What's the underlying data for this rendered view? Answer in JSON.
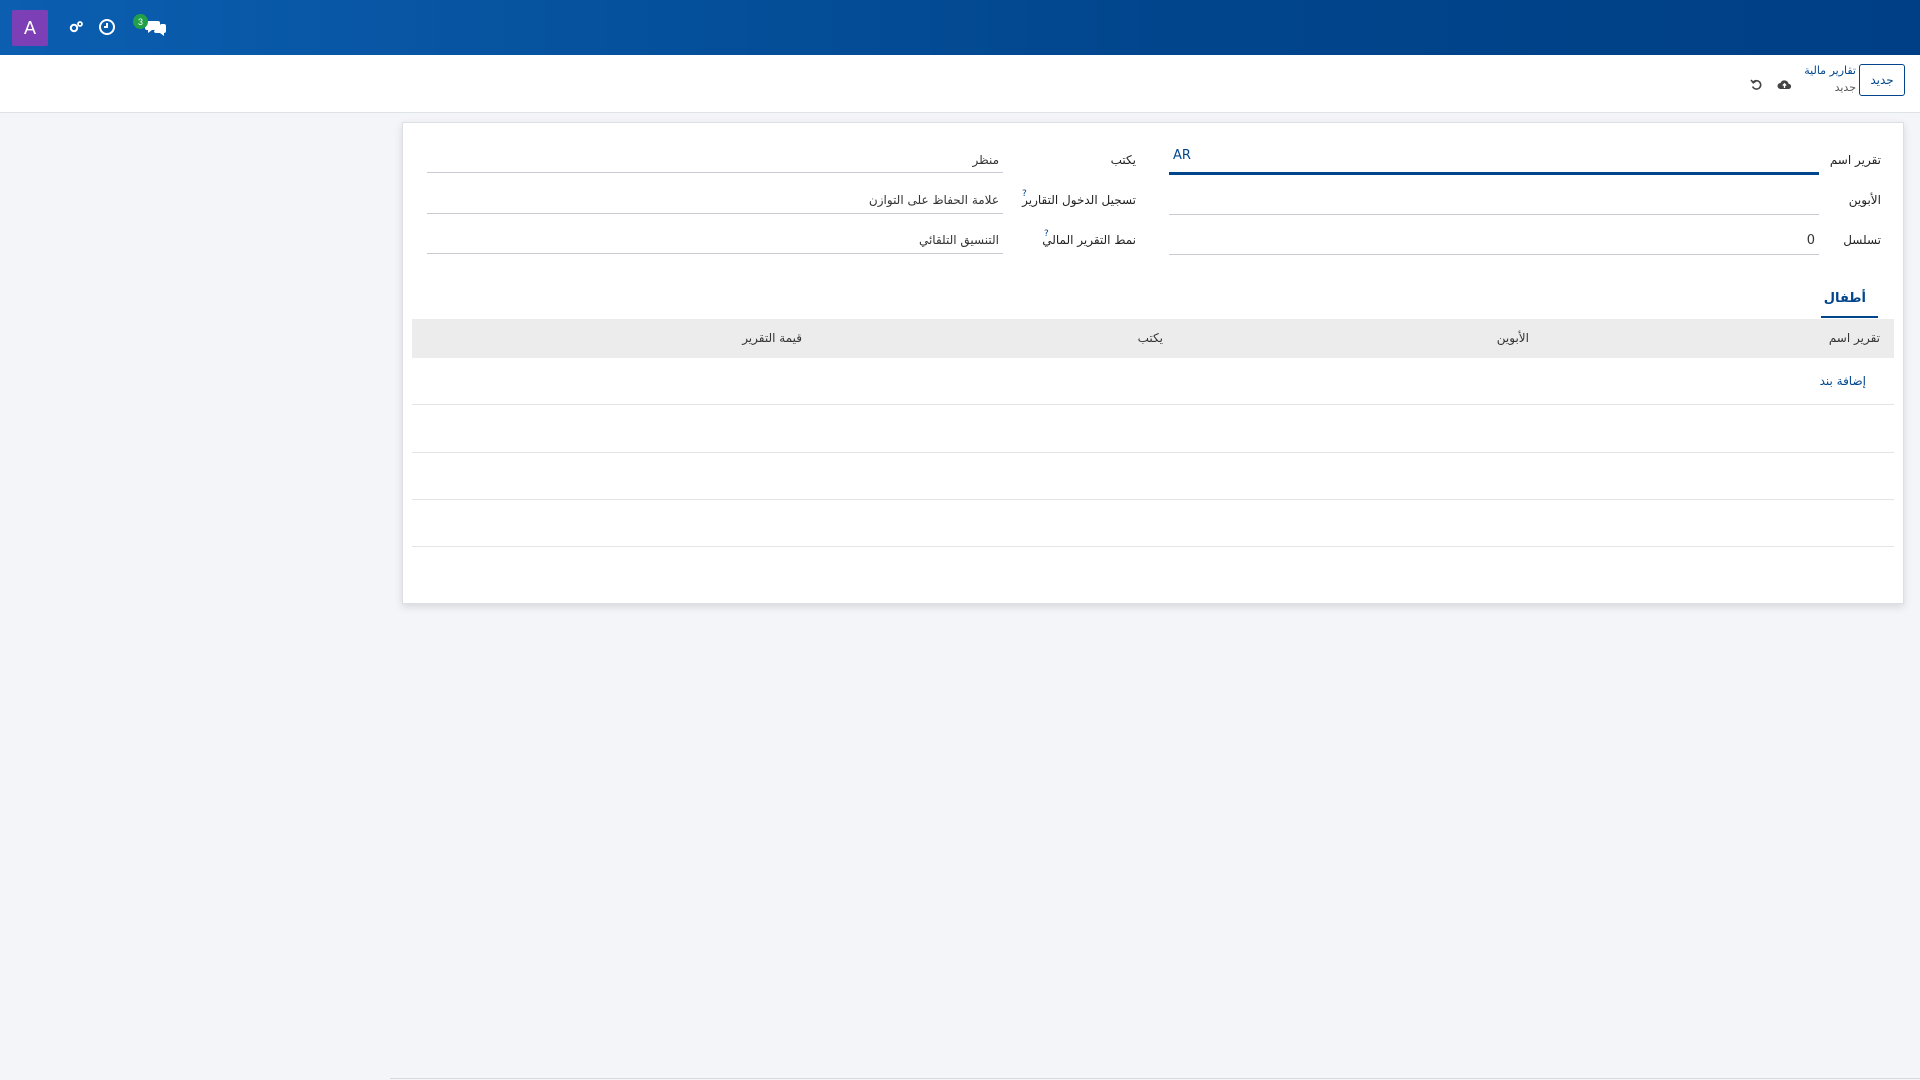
{
  "navbar": {
    "avatar_letter": "A",
    "icons": [
      "settings-icon",
      "clock-icon",
      "chat-icon"
    ],
    "chat_badge": "3"
  },
  "control_panel": {
    "new_button_label": "جديد",
    "breadcrumb_parent": "تقارير مالية",
    "breadcrumb_current": "جديد",
    "icons": [
      "upload-icon",
      "undo-icon"
    ]
  },
  "form": {
    "report_name_label": "تقرير اسم",
    "report_name_value": "AR",
    "parent_label": "الأبوين",
    "parent_value": "",
    "sequence_label": "تسلسل",
    "sequence_value": "0",
    "type_label": "يكتب",
    "type_value": "منظر",
    "journal_label": "تسجيل الدخول التقارير",
    "journal_value": "علامة الحفاظ على التوازن",
    "style_label": "نمط التقرير المالي",
    "style_value": "التنسيق التلقائي",
    "help_mark": "?"
  },
  "tabs": {
    "children_label": "أطفال"
  },
  "table": {
    "headers": [
      "تقرير اسم",
      "الأبوين",
      "يكتب",
      "قيمة التقرير"
    ],
    "add_line_label": "إضافة بند"
  },
  "colors": {
    "navbar": "#01468d",
    "avatar": "#7c3fb5",
    "badge": "#21a049",
    "accent": "#01468d"
  }
}
